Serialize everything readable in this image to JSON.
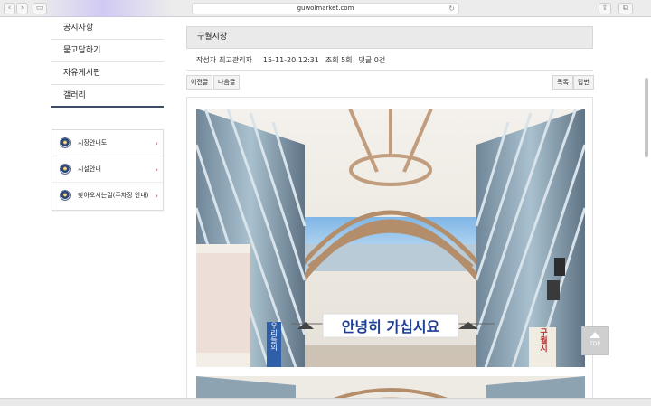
{
  "browser": {
    "url": "guwolmarket.com"
  },
  "sidebar": {
    "items": [
      {
        "label": "공지사항"
      },
      {
        "label": "묻고답하기"
      },
      {
        "label": "자유게시판"
      },
      {
        "label": "갤러리"
      }
    ]
  },
  "quick_links": {
    "items": [
      {
        "label": "시장안내도",
        "icon": "market-map-icon"
      },
      {
        "label": "시설안내",
        "icon": "facility-icon"
      },
      {
        "label": "찾아오시는길(주차장 안내)",
        "icon": "directions-icon"
      }
    ],
    "arrow": "›"
  },
  "post": {
    "title": "구월시장",
    "author_label": "작성자",
    "author": "최고관리자",
    "date": "15-11-20 12:31",
    "views": "조회 5회",
    "comments": "댓글 0건"
  },
  "buttons": {
    "prev": "이전글",
    "next": "다음글",
    "list": "목록",
    "reply": "답변"
  },
  "photo": {
    "banner_text": "안녕히 가십시요",
    "left_sign": "우리들의",
    "right_sign": "구월시"
  },
  "top_button": {
    "label": "TOP"
  },
  "colors": {
    "nav_active_underline": "#3d4b66",
    "arrow": "#e0395a",
    "title_bar": "#eaeaea"
  }
}
